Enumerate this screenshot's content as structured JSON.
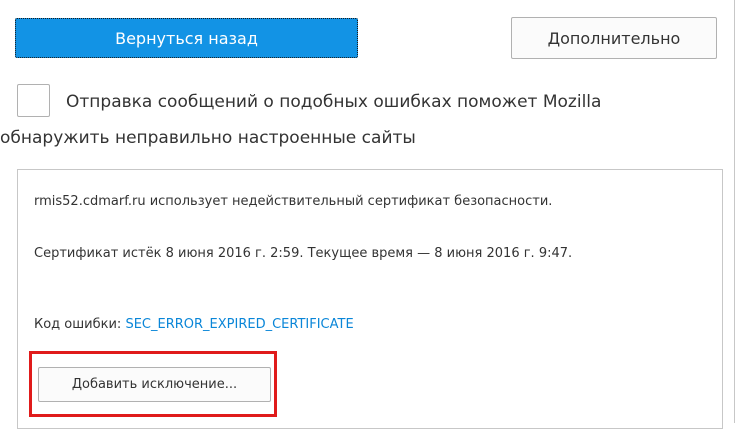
{
  "buttons": {
    "go_back": "Вернуться назад",
    "advanced": "Дополнительно",
    "add_exception": "Добавить исключение..."
  },
  "report": {
    "checked": false,
    "text": "Отправка сообщений о подобных ошибках поможет Mozilla обнаружить неправильно настроенные сайты"
  },
  "details": {
    "host_message": "rmis52.cdmarf.ru использует недействительный сертификат безопасности.",
    "cert_message": "Сертификат истёк 8 июня 2016 г. 2:59. Текущее время — 8 июня 2016 г. 9:47.",
    "error_code_label": "Код ошибки: ",
    "error_code": "SEC_ERROR_EXPIRED_CERTIFICATE"
  },
  "colors": {
    "primary_button": "#1293e5",
    "link": "#0a86d8",
    "highlight": "#e01b1b"
  }
}
